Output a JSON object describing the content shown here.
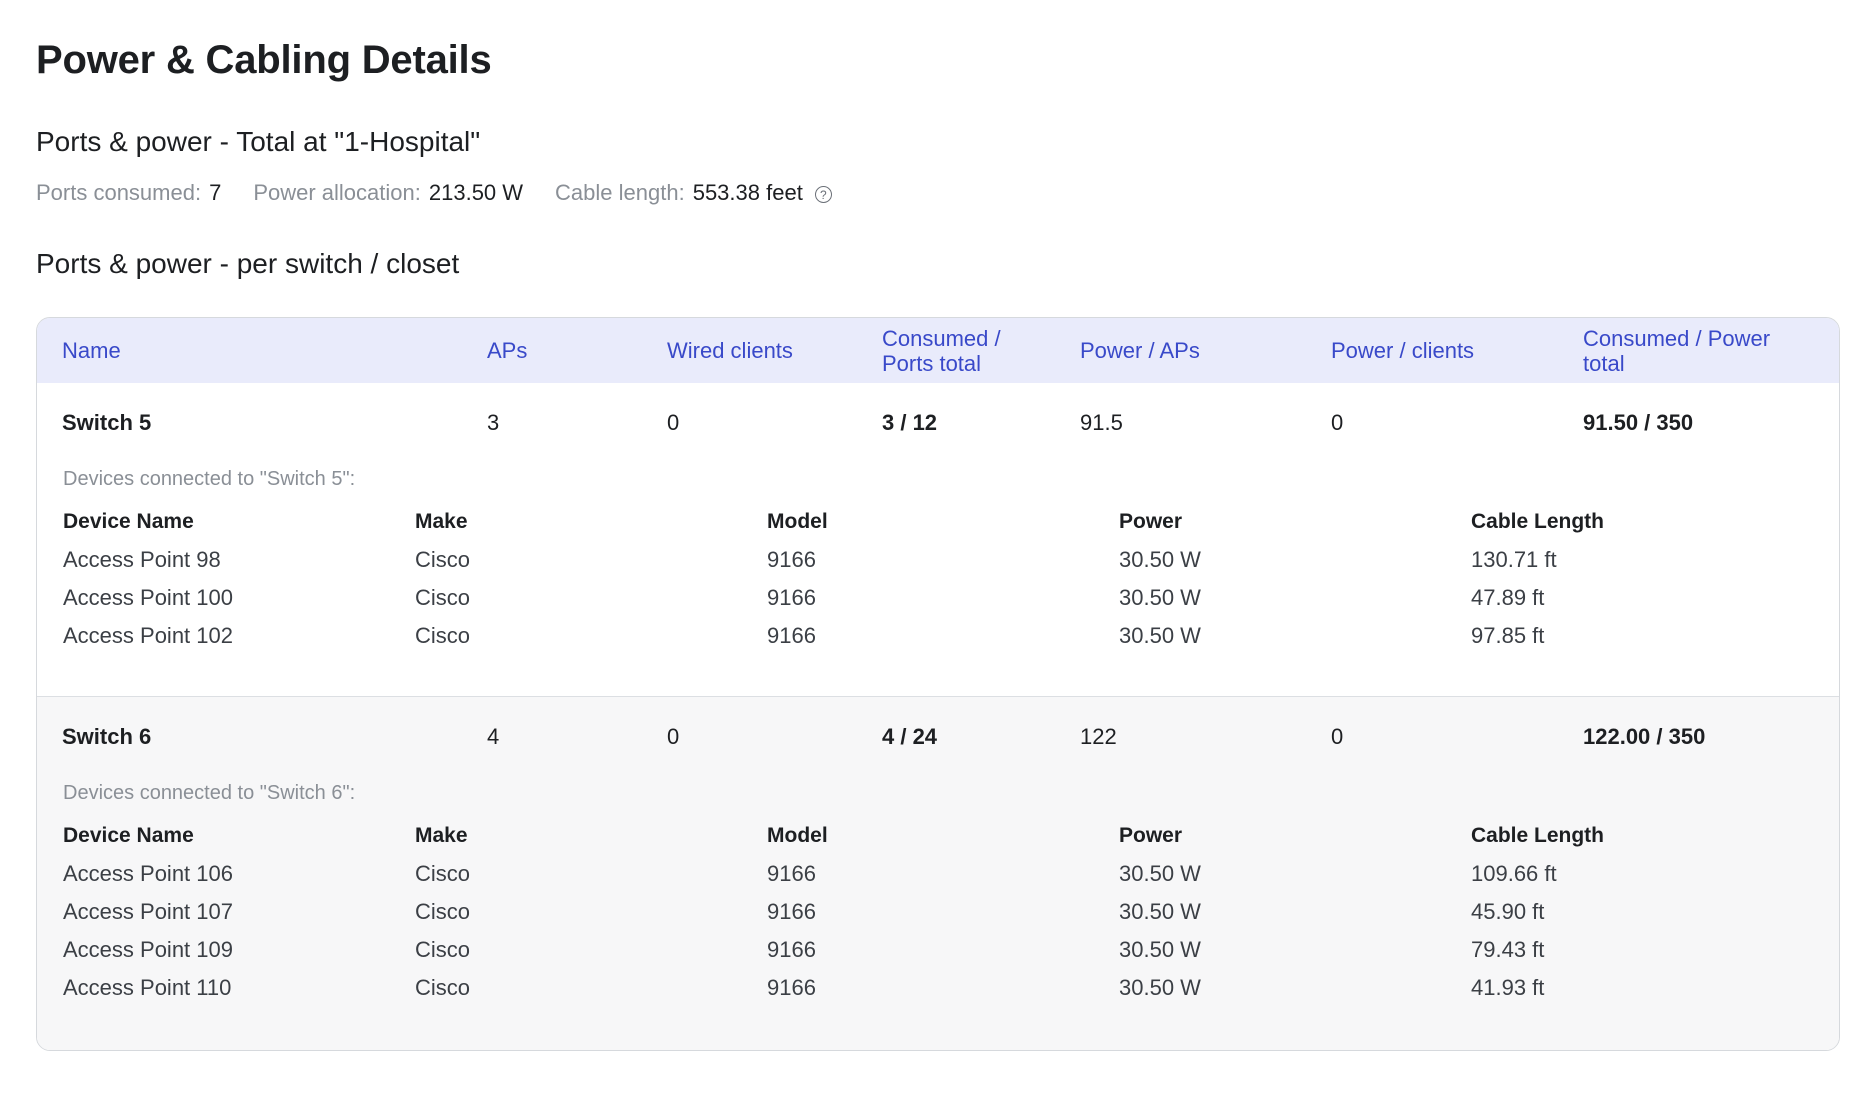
{
  "page_title": "Power & Cabling Details",
  "total_section": {
    "heading": "Ports & power - Total at \"1-Hospital\"",
    "ports_label": "Ports consumed:",
    "ports_value": "7",
    "power_label": "Power allocation:",
    "power_value": "213.50 W",
    "cable_label": "Cable length:",
    "cable_value": "553.38 feet",
    "help_icon": "question-circle-icon"
  },
  "per_switch_heading": "Ports & power - per switch / closet",
  "columns": {
    "name": "Name",
    "aps": "APs",
    "wired": "Wired clients",
    "consumed_ports_1": "Consumed /",
    "consumed_ports_2": "Ports total",
    "power_aps": "Power / APs",
    "power_clients": "Power / clients",
    "consumed_power_1": "Consumed / Power",
    "consumed_power_2": "total"
  },
  "device_columns": {
    "name": "Device Name",
    "make": "Make",
    "model": "Model",
    "power": "Power",
    "cable": "Cable Length"
  },
  "switches": [
    {
      "name": "Switch 5",
      "aps": "3",
      "wired": "0",
      "consumed_ports": "3 / 12",
      "power_aps": "91.5",
      "power_clients": "0",
      "consumed_power": "91.50 / 350",
      "devices_caption": "Devices connected to \"Switch 5\":",
      "devices": [
        {
          "name": "Access Point 98",
          "make": "Cisco",
          "model": "9166",
          "power": "30.50 W",
          "cable": "130.71 ft"
        },
        {
          "name": "Access Point 100",
          "make": "Cisco",
          "model": "9166",
          "power": "30.50 W",
          "cable": "47.89 ft"
        },
        {
          "name": "Access Point 102",
          "make": "Cisco",
          "model": "9166",
          "power": "30.50 W",
          "cable": "97.85 ft"
        }
      ]
    },
    {
      "name": "Switch 6",
      "aps": "4",
      "wired": "0",
      "consumed_ports": "4 / 24",
      "power_aps": "122",
      "power_clients": "0",
      "consumed_power": "122.00 / 350",
      "devices_caption": "Devices connected to \"Switch 6\":",
      "devices": [
        {
          "name": "Access Point 106",
          "make": "Cisco",
          "model": "9166",
          "power": "30.50 W",
          "cable": "109.66 ft"
        },
        {
          "name": "Access Point 107",
          "make": "Cisco",
          "model": "9166",
          "power": "30.50 W",
          "cable": "45.90 ft"
        },
        {
          "name": "Access Point 109",
          "make": "Cisco",
          "model": "9166",
          "power": "30.50 W",
          "cable": "79.43 ft"
        },
        {
          "name": "Access Point 110",
          "make": "Cisco",
          "model": "9166",
          "power": "30.50 W",
          "cable": "41.93 ft"
        }
      ]
    }
  ]
}
